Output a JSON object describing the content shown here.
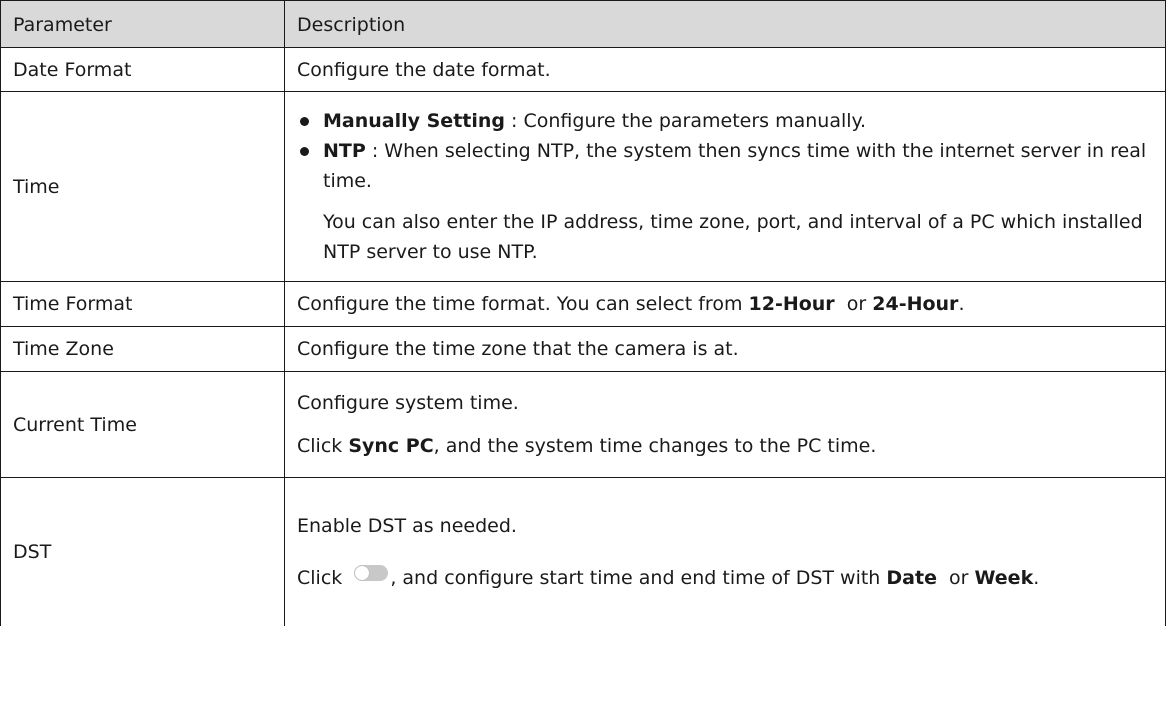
{
  "table": {
    "headers": [
      "Parameter",
      "Description"
    ],
    "rows": {
      "date_format": {
        "param": "Date Format",
        "desc": "Configure the date format."
      },
      "time": {
        "param": "Time",
        "manual": {
          "term": "Manually Setting",
          "text": " : Configure the parameters manually."
        },
        "ntp": {
          "term": "NTP",
          "text": " : When selecting NTP, the system then syncs time with the internet server in real time."
        },
        "note": "You can also enter the IP address, time zone, port, and interval of a PC which installed NTP server to use NTP."
      },
      "time_format": {
        "param": "Time Format",
        "pre": "Configure the time format. You can select from ",
        "opt1": "12-Hour",
        "mid": "  or ",
        "opt2": "24-Hour",
        "post": "."
      },
      "time_zone": {
        "param": "Time Zone",
        "desc": "Configure the time zone that the camera is at."
      },
      "current_time": {
        "param": "Current Time",
        "line1": "Configure system time.",
        "pre": "Click ",
        "btn": "Sync PC",
        "post": ", and the system time changes to the PC time."
      },
      "dst": {
        "param": "DST",
        "line1": "Enable DST as needed.",
        "pre": "Click ",
        "toggle_icon": "toggle-switch-off-icon",
        "mid": ", and configure start time and end time of DST with ",
        "opt1": "Date",
        "or": "  or ",
        "opt2": "Week",
        "post": "."
      }
    }
  }
}
